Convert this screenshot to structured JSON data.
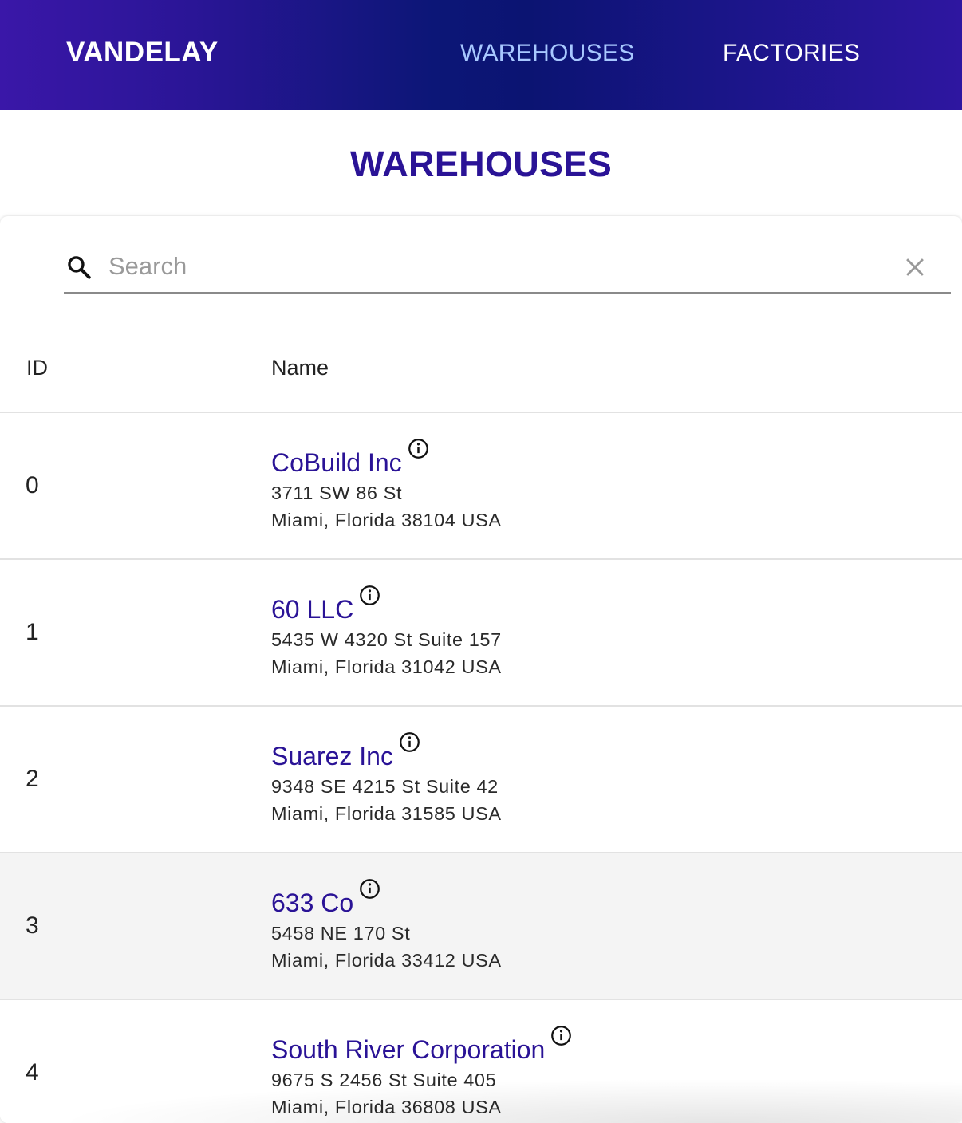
{
  "header": {
    "brand": "VANDELAY",
    "nav": [
      {
        "label": "WAREHOUSES",
        "active": true
      },
      {
        "label": "FACTORIES",
        "active": false
      }
    ]
  },
  "page": {
    "title": "WAREHOUSES"
  },
  "search": {
    "placeholder": "Search",
    "value": ""
  },
  "table": {
    "columns": [
      "ID",
      "Name"
    ],
    "rows": [
      {
        "id": "0",
        "name": "CoBuild Inc",
        "address_line1": "3711 SW 86 St",
        "address_line2": "Miami, Florida 38104 USA"
      },
      {
        "id": "1",
        "name": "60 LLC",
        "address_line1": "5435 W 4320 St Suite 157",
        "address_line2": "Miami, Florida 31042 USA"
      },
      {
        "id": "2",
        "name": "Suarez Inc",
        "address_line1": "9348 SE 4215 St Suite 42",
        "address_line2": "Miami, Florida 31585 USA"
      },
      {
        "id": "3",
        "name": "633 Co",
        "address_line1": "5458 NE 170 St",
        "address_line2": "Miami, Florida 33412 USA"
      },
      {
        "id": "4",
        "name": "South River Corporation",
        "address_line1": "9675 S 2456 St Suite 405",
        "address_line2": "Miami, Florida 36808 USA"
      }
    ]
  },
  "colors": {
    "accent": "#2a1396",
    "nav_active": "#a8c8ff",
    "header_gradient_mid": "#0b1472"
  },
  "icons": {
    "search": "search-icon",
    "clear": "close-icon",
    "info": "info-icon"
  }
}
